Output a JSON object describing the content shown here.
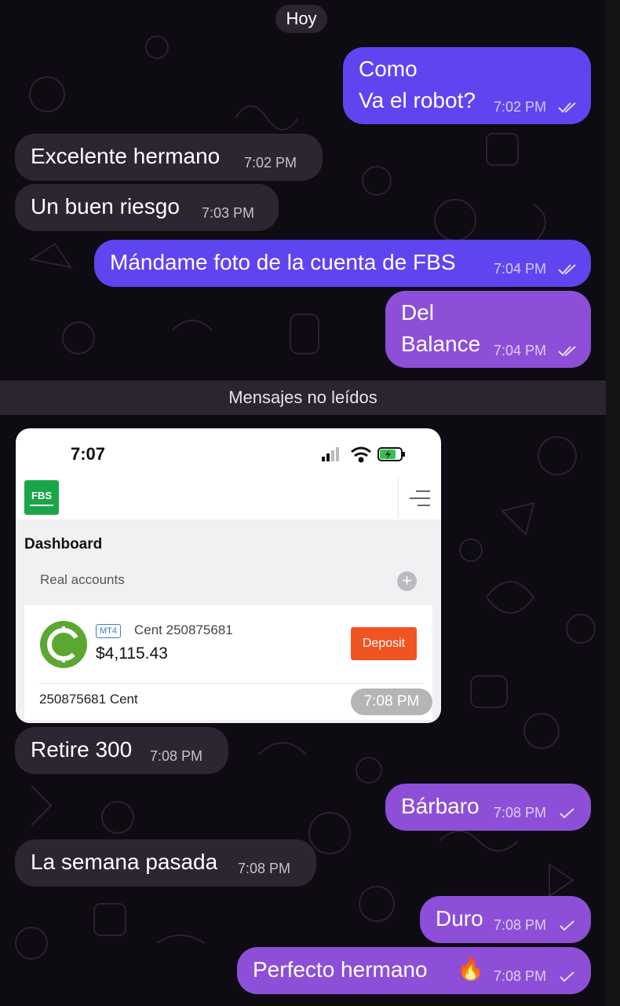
{
  "chat": {
    "date_label": "Hoy",
    "unread_label": "Mensajes no leídos",
    "messages": [
      {
        "text_line1": "Como",
        "text_line2": "Va el robot?",
        "time": "7:02 PM",
        "status": "read"
      },
      {
        "text": "Excelente hermano",
        "time": "7:02 PM"
      },
      {
        "text": "Un buen riesgo",
        "time": "7:03 PM"
      },
      {
        "text": "Mándame foto de la cuenta de FBS",
        "time": "7:04 PM",
        "status": "read"
      },
      {
        "text_line1": "Del",
        "text_line2": "Balance",
        "time": "7:04 PM",
        "status": "read"
      },
      {
        "text": "Retire 300",
        "time": "7:08 PM"
      },
      {
        "text": "Bárbaro",
        "time": "7:08 PM",
        "status": "sent"
      },
      {
        "text": "La semana pasada",
        "time": "7:08 PM"
      },
      {
        "text": "Duro",
        "time": "7:08 PM",
        "status": "sent"
      },
      {
        "text": "Perfecto hermano",
        "emoji": "🔥",
        "time": "7:08 PM",
        "status": "sent"
      }
    ],
    "photo_time": "7:08 PM"
  },
  "screenshot": {
    "status_time": "7:07",
    "logo_text": "FBS",
    "dashboard_title": "Dashboard",
    "section_label": "Real accounts",
    "account": {
      "platform_badge": "MT4",
      "type_label": "Cent 250875681",
      "balance": "$4,115.43",
      "deposit_label": "Deposit",
      "footer_label": "250875681  Cent"
    }
  },
  "colors": {
    "background": "#0e0b12",
    "incoming_bubble": "#2c2632",
    "outgoing_blue": "#5e45f0",
    "outgoing_purple": "#8d4fd8",
    "fbs_green": "#1aa648",
    "deposit_orange": "#f25322"
  },
  "icons": [
    "double-check-icon",
    "single-check-icon",
    "fire-emoji",
    "signal-icon",
    "wifi-icon",
    "battery-icon",
    "menu-icon",
    "plus-icon",
    "coin-icon"
  ]
}
